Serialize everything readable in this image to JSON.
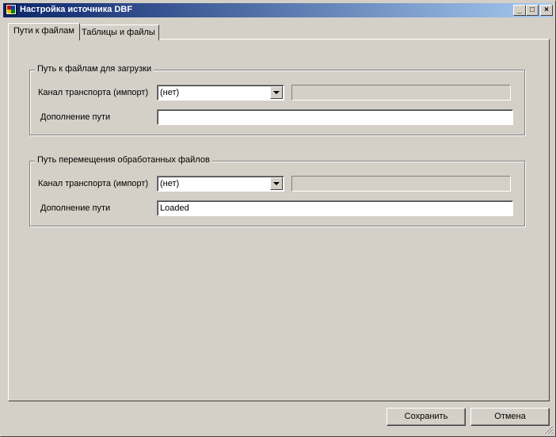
{
  "window": {
    "title": "Настройка источника DBF",
    "controls": {
      "minimize": "_",
      "maximize": "□",
      "close": "×"
    }
  },
  "tabs": [
    {
      "label": "Пути к файлам",
      "active": true
    },
    {
      "label": "Таблицы и файлы",
      "active": false
    }
  ],
  "load_group": {
    "legend": "Путь к файлам для загрузки",
    "transport_label": "Канал транспорта (импорт)",
    "transport_value": "(нет)",
    "path_display": "",
    "path_addition_label": "Дополнение пути",
    "path_addition_value": ""
  },
  "move_group": {
    "legend": "Путь перемещения обработанных файлов",
    "transport_label": "Канал транспорта (импорт)",
    "transport_value": "(нет)",
    "path_display": "",
    "path_addition_label": "Дополнение пути",
    "path_addition_value": "Loaded"
  },
  "buttons": {
    "save": "Сохранить",
    "cancel": "Отмена"
  },
  "colors": {
    "face": "#d4d0c8",
    "title_start": "#0a246a",
    "title_end": "#a6caf0"
  }
}
